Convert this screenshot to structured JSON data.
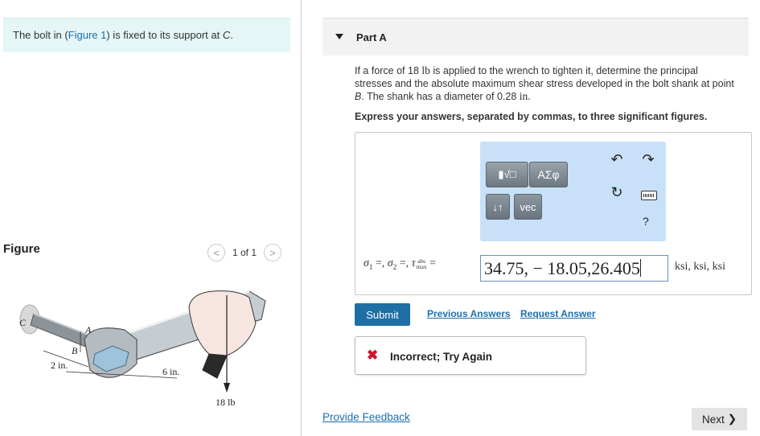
{
  "intro": {
    "prefix": "The bolt in (",
    "figure_link": "Figure 1",
    "suffix": ") is fixed to its support at ",
    "point": "C",
    "end": "."
  },
  "figure_panel": {
    "label": "Figure",
    "pager_text": "1 of 1",
    "prev_symbol": "<",
    "next_symbol": ">",
    "labels": {
      "c": "C",
      "a": "A",
      "b": "B",
      "dim1": "2 in.",
      "dim2": "6 in.",
      "force": "18 lb"
    }
  },
  "part": {
    "title": "Part A",
    "question_1": "If a force of 18 ",
    "force_unit": "lb",
    "question_2": " is applied to the wrench to tighten it, determine the principal stresses and the absolute maximum shear stress developed in the bolt shank at point ",
    "point": "B",
    "question_3": ". The shank has a diameter of 0.28 ",
    "dia_unit": "in.",
    "instruction": "Express your answers, separated by commas, to three significant figures."
  },
  "toolbar": {
    "templates_label": "▮√□",
    "symbols_label": "ΑΣφ",
    "arrows_label": "↓↑",
    "vec_label": "vec",
    "help_label": "?",
    "undo_icon": "undo-icon",
    "redo_icon": "redo-icon",
    "reset_icon": "reset-icon",
    "keyboard_icon": "keyboard-icon"
  },
  "answer": {
    "label_sigma1": "σ",
    "label_sigma1_sub": "1",
    "label_sigma2": "σ",
    "label_sigma2_sub": "2",
    "label_tau": "τ",
    "label_tau_sub_top": "abs",
    "label_tau_sub_bottom": "max",
    "label_sep": " =, ",
    "label_equals": "=",
    "value": "34.75, − 18.05,26.405",
    "units": "ksi, ksi, ksi"
  },
  "actions": {
    "submit": "Submit",
    "previous_answers": "Previous Answers",
    "request_answer": "Request Answer"
  },
  "feedback": {
    "icon": "✖",
    "message": "Incorrect; Try Again"
  },
  "footer": {
    "provide_feedback": "Provide Feedback",
    "next": "Next",
    "next_chevron": "❯"
  },
  "colors": {
    "intro_bg": "#e4f6f6",
    "toolbar_bg": "#c8e1f9",
    "submit_bg": "#1d6fa5",
    "link": "#1b6fb0",
    "error": "#d0142c"
  }
}
